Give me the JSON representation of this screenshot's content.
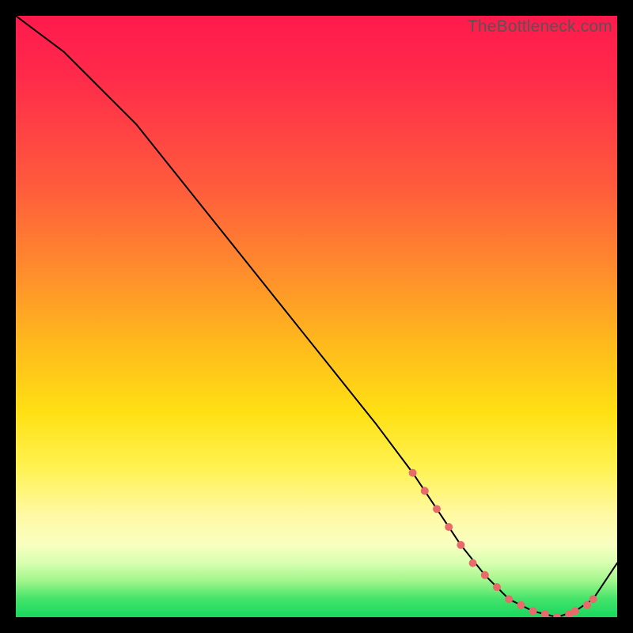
{
  "watermark": "TheBottleneck.com",
  "chart_data": {
    "type": "line",
    "title": "",
    "xlabel": "",
    "ylabel": "",
    "xlim": [
      0,
      100
    ],
    "ylim": [
      0,
      100
    ],
    "grid": false,
    "series": [
      {
        "name": "bottleneck-curve",
        "x": [
          0,
          4,
          8,
          12,
          16,
          20,
          28,
          36,
          44,
          52,
          60,
          66,
          70,
          74,
          78,
          82,
          86,
          90,
          93,
          96,
          100
        ],
        "y": [
          100,
          97,
          94,
          90,
          86,
          82,
          72,
          62,
          52,
          42,
          32,
          24,
          18,
          12,
          7,
          3,
          1,
          0,
          1,
          3,
          9
        ]
      }
    ],
    "markers": {
      "name": "highlight-dots",
      "x": [
        66,
        68,
        70,
        72,
        74,
        76,
        78,
        80,
        82,
        84,
        86,
        88,
        90,
        92,
        93,
        95,
        96
      ],
      "y": [
        24,
        21,
        18,
        15,
        12,
        9,
        7,
        5,
        3,
        2,
        1,
        0.5,
        0,
        0.5,
        1,
        2,
        3
      ]
    }
  }
}
